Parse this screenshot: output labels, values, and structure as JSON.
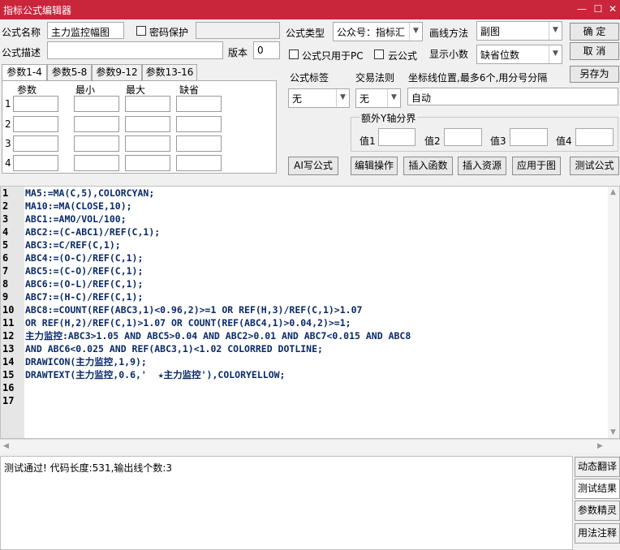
{
  "window": {
    "title": "指标公式编辑器",
    "minimize": "—",
    "maximize": "☐",
    "close": "✕"
  },
  "form": {
    "name_label": "公式名称",
    "name_value": "主力监控幅图",
    "password_label": "密码保护",
    "desc_label": "公式描述",
    "desc_value": "",
    "version_label": "版本",
    "version_value": "0",
    "type_label": "公式类型",
    "type_value": "公众号：指标汇",
    "only_pc_label": "公式只用于PC",
    "cloud_label": "云公式",
    "draw_method_label": "画线方法",
    "draw_method_value": "副图",
    "decimals_label": "显示小数",
    "decimals_value": "缺省位数",
    "tag_label": "公式标签",
    "tag_value": "无",
    "trade_rule_label": "交易法则",
    "trade_rule_value": "无",
    "coord_label": "坐标线位置,最多6个,用分号分隔",
    "coord_value": "自动",
    "yaxis_group_label": "额外Y轴分界",
    "y_values": [
      {
        "label": "值1",
        "value": ""
      },
      {
        "label": "值2",
        "value": ""
      },
      {
        "label": "值3",
        "value": ""
      },
      {
        "label": "值4",
        "value": ""
      }
    ]
  },
  "buttons": {
    "ok": "确 定",
    "cancel": "取 消",
    "save_as": "另存为",
    "ai_write": "AI写公式",
    "edit_ops": "编辑操作",
    "insert_func": "插入函数",
    "insert_resource": "插入资源",
    "apply_chart": "应用于图",
    "test_formula": "测试公式"
  },
  "tabs": [
    "参数1-4",
    "参数5-8",
    "参数9-12",
    "参数13-16"
  ],
  "params": {
    "headers": [
      "参数",
      "最小",
      "最大",
      "缺省"
    ],
    "rows": [
      "1",
      "2",
      "3",
      "4"
    ]
  },
  "code": {
    "line_numbers": [
      "1",
      "2",
      "3",
      "4",
      "5",
      "6",
      "7",
      "8",
      "9",
      "10",
      "11",
      "12",
      "13",
      "14",
      "15",
      "16",
      "17"
    ],
    "lines": [
      "MA5:=MA(C,5),COLORCYAN;",
      "MA10:=MA(CLOSE,10);",
      "ABC1:=AMO/VOL/100;",
      "ABC2:=(C-ABC1)/REF(C,1);",
      "ABC3:=C/REF(C,1);",
      "ABC4:=(O-C)/REF(C,1);",
      "ABC5:=(C-O)/REF(C,1);",
      "ABC6:=(O-L)/REF(C,1);",
      "ABC7:=(H-C)/REF(C,1);",
      "ABC8:=COUNT(REF(ABC3,1)<0.96,2)>=1 OR REF(H,3)/REF(C,1)>1.07",
      "OR REF(H,2)/REF(C,1)>1.07 OR COUNT(REF(ABC4,1)>0.04,2)>=1;",
      "主力监控:ABC3>1.05 AND ABC5>0.04 AND ABC2>0.01 AND ABC7<0.015 AND ABC8",
      "AND ABC6<0.025 AND REF(ABC3,1)<1.02 COLORRED DOTLINE;",
      "DRAWICON(主力监控,1,9);",
      "DRAWTEXT(主力监控,0.6,'  ★主力监控'),COLORYELLOW;",
      "",
      ""
    ]
  },
  "status": {
    "message": "测试通过! 代码长度:531,输出线个数:3"
  },
  "side_buttons": [
    "动态翻译",
    "测试结果",
    "参数精灵",
    "用法注释"
  ],
  "colors": {
    "titlebar": "#c9253b",
    "keyword": "#0a2a6a"
  }
}
